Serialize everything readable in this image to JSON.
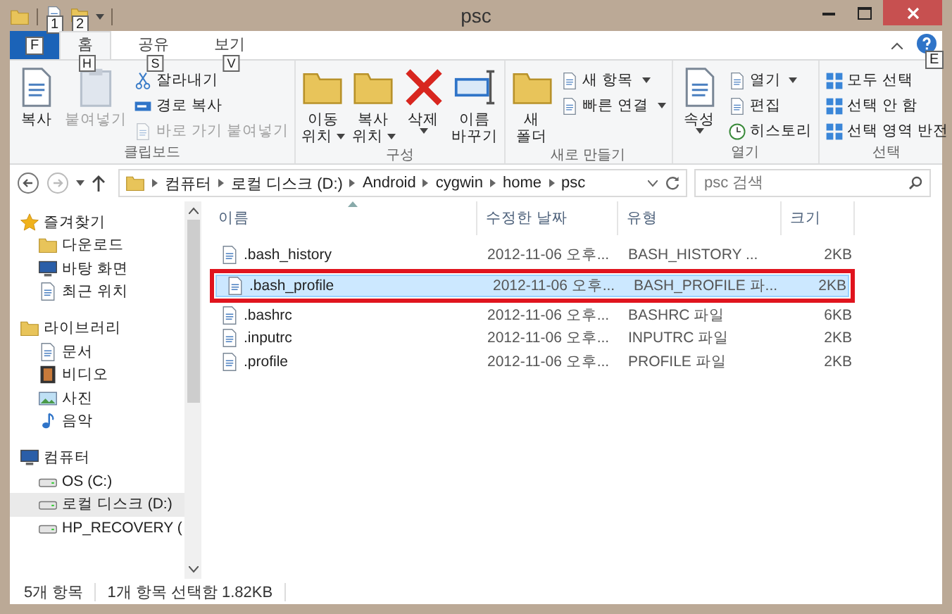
{
  "title_bar": {
    "title": "psc",
    "keytips": [
      "1",
      "2"
    ]
  },
  "ribbon": {
    "tabs": [
      {
        "kind": "file",
        "keytip": "F",
        "selected": false
      },
      {
        "kind": "tab",
        "label": "홈",
        "keytip": "H",
        "selected": true
      },
      {
        "kind": "tab",
        "label": "공유",
        "keytip": "S",
        "selected": false
      },
      {
        "kind": "tab",
        "label": "보기",
        "keytip": "V",
        "selected": false
      }
    ],
    "help_keytip": "E",
    "groups": [
      {
        "label": "클립보드",
        "large": [
          {
            "lines": [
              "복사"
            ],
            "dropdown": false,
            "disabled": false
          },
          {
            "lines": [
              "붙여넣기"
            ],
            "dropdown": false,
            "disabled": true
          }
        ],
        "small": [
          {
            "label": "잘라내기",
            "dropdown": false,
            "disabled": false
          },
          {
            "label": "경로 복사",
            "dropdown": false,
            "disabled": false
          },
          {
            "label": "바로 가기 붙여넣기",
            "dropdown": false,
            "disabled": true
          }
        ]
      },
      {
        "label": "구성",
        "large": [
          {
            "lines": [
              "이동",
              "위치"
            ],
            "dropdown": true,
            "disabled": false
          },
          {
            "lines": [
              "복사",
              "위치"
            ],
            "dropdown": true,
            "disabled": false
          },
          {
            "lines": [
              "삭제"
            ],
            "dropdown": true,
            "disabled": false
          },
          {
            "lines": [
              "이름",
              "바꾸기"
            ],
            "dropdown": false,
            "disabled": false
          }
        ]
      },
      {
        "label": "새로 만들기",
        "large": [
          {
            "lines": [
              "새",
              "폴더"
            ],
            "dropdown": false,
            "disabled": false
          }
        ],
        "small": [
          {
            "label": "새 항목",
            "dropdown": true,
            "disabled": false
          },
          {
            "label": "빠른 연결",
            "dropdown": true,
            "disabled": false
          }
        ]
      },
      {
        "label": "열기",
        "large": [
          {
            "lines": [
              "속성"
            ],
            "dropdown": true,
            "disabled": false
          }
        ],
        "small": [
          {
            "label": "열기",
            "dropdown": true,
            "disabled": false
          },
          {
            "label": "편집",
            "dropdown": false,
            "disabled": false
          },
          {
            "label": "히스토리",
            "dropdown": false,
            "disabled": false
          }
        ]
      },
      {
        "label": "선택",
        "small": [
          {
            "label": "모두 선택",
            "dropdown": false,
            "disabled": false
          },
          {
            "label": "선택 안 함",
            "dropdown": false,
            "disabled": false
          },
          {
            "label": "선택 영역 반전",
            "dropdown": false,
            "disabled": false
          }
        ]
      }
    ]
  },
  "address_bar": {
    "crumbs": [
      "컴퓨터",
      "로컬 디스크 (D:)",
      "Android",
      "cygwin",
      "home",
      "psc"
    ],
    "search": {
      "placeholder": "psc 검색"
    }
  },
  "navigation": [
    {
      "label": "즐겨찾기",
      "children": [
        {
          "label": "다운로드",
          "selected": false
        },
        {
          "label": "바탕 화면",
          "selected": false
        },
        {
          "label": "최근 위치",
          "selected": false
        }
      ]
    },
    {
      "label": "라이브러리",
      "children": [
        {
          "label": "문서",
          "selected": false
        },
        {
          "label": "비디오",
          "selected": false
        },
        {
          "label": "사진",
          "selected": false
        },
        {
          "label": "음악",
          "selected": false
        }
      ]
    },
    {
      "label": "컴퓨터",
      "children": [
        {
          "label": "OS (C:)",
          "selected": false
        },
        {
          "label": "로컬 디스크 (D:)",
          "selected": true
        },
        {
          "label": "HP_RECOVERY (",
          "selected": false
        }
      ]
    }
  ],
  "file_list": {
    "columns": [
      "이름",
      "수정한 날짜",
      "유형",
      "크기"
    ],
    "rows": [
      {
        "name": ".bash_history",
        "modified": "2012-11-06 오후...",
        "type": "BASH_HISTORY ...",
        "size": "2KB",
        "selected": false,
        "highlighted": false
      },
      {
        "name": ".bash_profile",
        "modified": "2012-11-06 오후...",
        "type": "BASH_PROFILE 파...",
        "size": "2KB",
        "selected": true,
        "highlighted": true
      },
      {
        "name": ".bashrc",
        "modified": "2012-11-06 오후...",
        "type": "BASHRC 파일",
        "size": "6KB",
        "selected": false,
        "highlighted": false
      },
      {
        "name": ".inputrc",
        "modified": "2012-11-06 오후...",
        "type": "INPUTRC 파일",
        "size": "2KB",
        "selected": false,
        "highlighted": false
      },
      {
        "name": ".profile",
        "modified": "2012-11-06 오후...",
        "type": "PROFILE 파일",
        "size": "2KB",
        "selected": false,
        "highlighted": false
      }
    ]
  },
  "status_bar": {
    "item_count": "5개 항목",
    "selection": "1개 항목 선택함 1.82KB"
  }
}
